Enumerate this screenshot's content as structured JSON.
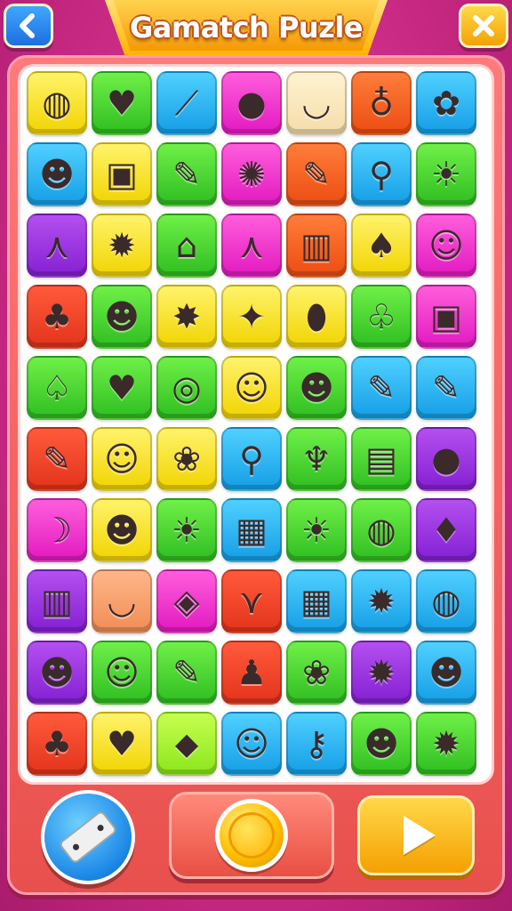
{
  "header": {
    "title": "Gamatch Puzle",
    "back_icon": "chevron-left-icon",
    "close_icon": "close-icon"
  },
  "colors": {
    "background": "#c3267f",
    "frame": "#e8504d",
    "title_banner": "#ffb300",
    "back_button": "#1c6fe0",
    "close_button": "#f4a200"
  },
  "board": {
    "columns": 7,
    "rows": 10,
    "tiles": [
      {
        "icon": "beach-ball-icon",
        "glyph": "◍",
        "color": "yellow"
      },
      {
        "icon": "strawberry-icon",
        "glyph": "♥",
        "color": "green"
      },
      {
        "icon": "feather-icon",
        "glyph": "⟋",
        "color": "blue"
      },
      {
        "icon": "ball-icon",
        "glyph": "●",
        "color": "pink"
      },
      {
        "icon": "bowl-icon",
        "glyph": "◡",
        "color": "cream"
      },
      {
        "icon": "pin-icon",
        "glyph": "♁",
        "color": "orange"
      },
      {
        "icon": "flower-monster-icon",
        "glyph": "✿",
        "color": "blue"
      },
      {
        "icon": "bear-icon",
        "glyph": "☻",
        "color": "blue"
      },
      {
        "icon": "robot-bag-icon",
        "glyph": "▣",
        "color": "yellow"
      },
      {
        "icon": "pencil-icon",
        "glyph": "✎",
        "color": "green"
      },
      {
        "icon": "grape-monster-icon",
        "glyph": "✺",
        "color": "pink"
      },
      {
        "icon": "pencil-icon",
        "glyph": "✎",
        "color": "orange"
      },
      {
        "icon": "spoon-icon",
        "glyph": "⚲",
        "color": "blue"
      },
      {
        "icon": "sun-icon",
        "glyph": "☀",
        "color": "green"
      },
      {
        "icon": "easel-icon",
        "glyph": "⋏",
        "color": "purple"
      },
      {
        "icon": "hedgehog-icon",
        "glyph": "✹",
        "color": "yellow"
      },
      {
        "icon": "house-icon",
        "glyph": "⌂",
        "color": "green"
      },
      {
        "icon": "easel-icon",
        "glyph": "⋏",
        "color": "pink"
      },
      {
        "icon": "crayons-icon",
        "glyph": "▥",
        "color": "orange"
      },
      {
        "icon": "lollipop-icon",
        "glyph": "♠",
        "color": "yellow"
      },
      {
        "icon": "deer-icon",
        "glyph": "☺",
        "color": "pink"
      },
      {
        "icon": "lollipop-icon",
        "glyph": "♣",
        "color": "red"
      },
      {
        "icon": "slime-icon",
        "glyph": "☻",
        "color": "green"
      },
      {
        "icon": "cat-icon",
        "glyph": "✸",
        "color": "yellow"
      },
      {
        "icon": "propeller-icon",
        "glyph": "✦",
        "color": "yellow"
      },
      {
        "icon": "bandage-icon",
        "glyph": "⬮",
        "color": "yellow"
      },
      {
        "icon": "potion-icon",
        "glyph": "♧",
        "color": "green"
      },
      {
        "icon": "robot-bag-icon",
        "glyph": "▣",
        "color": "pink"
      },
      {
        "icon": "whisk-icon",
        "glyph": "♤",
        "color": "green"
      },
      {
        "icon": "leaf-icon",
        "glyph": "♥",
        "color": "green"
      },
      {
        "icon": "yarn-ball-icon",
        "glyph": "◎",
        "color": "green"
      },
      {
        "icon": "ghost-icon",
        "glyph": "☺",
        "color": "yellow"
      },
      {
        "icon": "rabbit-icon",
        "glyph": "☻",
        "color": "green"
      },
      {
        "icon": "pencil-icon",
        "glyph": "✎",
        "color": "blue"
      },
      {
        "icon": "pencil-icon",
        "glyph": "✎",
        "color": "blue"
      },
      {
        "icon": "pencil-icon",
        "glyph": "✎",
        "color": "red"
      },
      {
        "icon": "ghost-icon",
        "glyph": "☺",
        "color": "yellow"
      },
      {
        "icon": "cotton-candy-icon",
        "glyph": "❀",
        "color": "yellow"
      },
      {
        "icon": "magnifier-icon",
        "glyph": "⚲",
        "color": "blue"
      },
      {
        "icon": "palm-tree-icon",
        "glyph": "♆",
        "color": "green"
      },
      {
        "icon": "drum-icon",
        "glyph": "▤",
        "color": "green"
      },
      {
        "icon": "orange-icon",
        "glyph": "●",
        "color": "purple"
      },
      {
        "icon": "bow-icon",
        "glyph": "☽",
        "color": "pink"
      },
      {
        "icon": "alien-icon",
        "glyph": "☻",
        "color": "yellow"
      },
      {
        "icon": "sun-icon",
        "glyph": "☀",
        "color": "green"
      },
      {
        "icon": "cracker-icon",
        "glyph": "▦",
        "color": "blue"
      },
      {
        "icon": "sun-icon",
        "glyph": "☀",
        "color": "green"
      },
      {
        "icon": "ball-icon",
        "glyph": "◍",
        "color": "green"
      },
      {
        "icon": "carrot-icon",
        "glyph": "♦",
        "color": "purple"
      },
      {
        "icon": "books-icon",
        "glyph": "▥",
        "color": "purple"
      },
      {
        "icon": "bowl-icon",
        "glyph": "◡",
        "color": "tan"
      },
      {
        "icon": "rattle-icon",
        "glyph": "◈",
        "color": "pink"
      },
      {
        "icon": "slingshot-icon",
        "glyph": "⋎",
        "color": "red"
      },
      {
        "icon": "blocks-icon",
        "glyph": "▦",
        "color": "blue"
      },
      {
        "icon": "lion-icon",
        "glyph": "✹",
        "color": "blue"
      },
      {
        "icon": "beach-ball-icon",
        "glyph": "◍",
        "color": "blue"
      },
      {
        "icon": "bunny-icon",
        "glyph": "☻",
        "color": "purple"
      },
      {
        "icon": "chick-icon",
        "glyph": "☺",
        "color": "green"
      },
      {
        "icon": "pencil-icon",
        "glyph": "✎",
        "color": "green"
      },
      {
        "icon": "mushroom-icon",
        "glyph": "♟",
        "color": "red"
      },
      {
        "icon": "brain-candy-icon",
        "glyph": "❀",
        "color": "green"
      },
      {
        "icon": "tree-monster-icon",
        "glyph": "✹",
        "color": "purple"
      },
      {
        "icon": "bear-icon",
        "glyph": "☻",
        "color": "blue"
      },
      {
        "icon": "lollipop-icon",
        "glyph": "♣",
        "color": "red"
      },
      {
        "icon": "strawberry-icon",
        "glyph": "♥",
        "color": "yellow"
      },
      {
        "icon": "popsicle-icon",
        "glyph": "⬥",
        "color": "lime"
      },
      {
        "icon": "chick-icon",
        "glyph": "☺",
        "color": "blue"
      },
      {
        "icon": "wand-icon",
        "glyph": "⚷",
        "color": "blue"
      },
      {
        "icon": "cat-blob-icon",
        "glyph": "☻",
        "color": "green"
      },
      {
        "icon": "sun-monster-icon",
        "glyph": "✹",
        "color": "green"
      }
    ]
  },
  "controls": {
    "shuffle_icon": "card-icon",
    "hint_icon": "coin-icon",
    "play_icon": "play-icon"
  }
}
